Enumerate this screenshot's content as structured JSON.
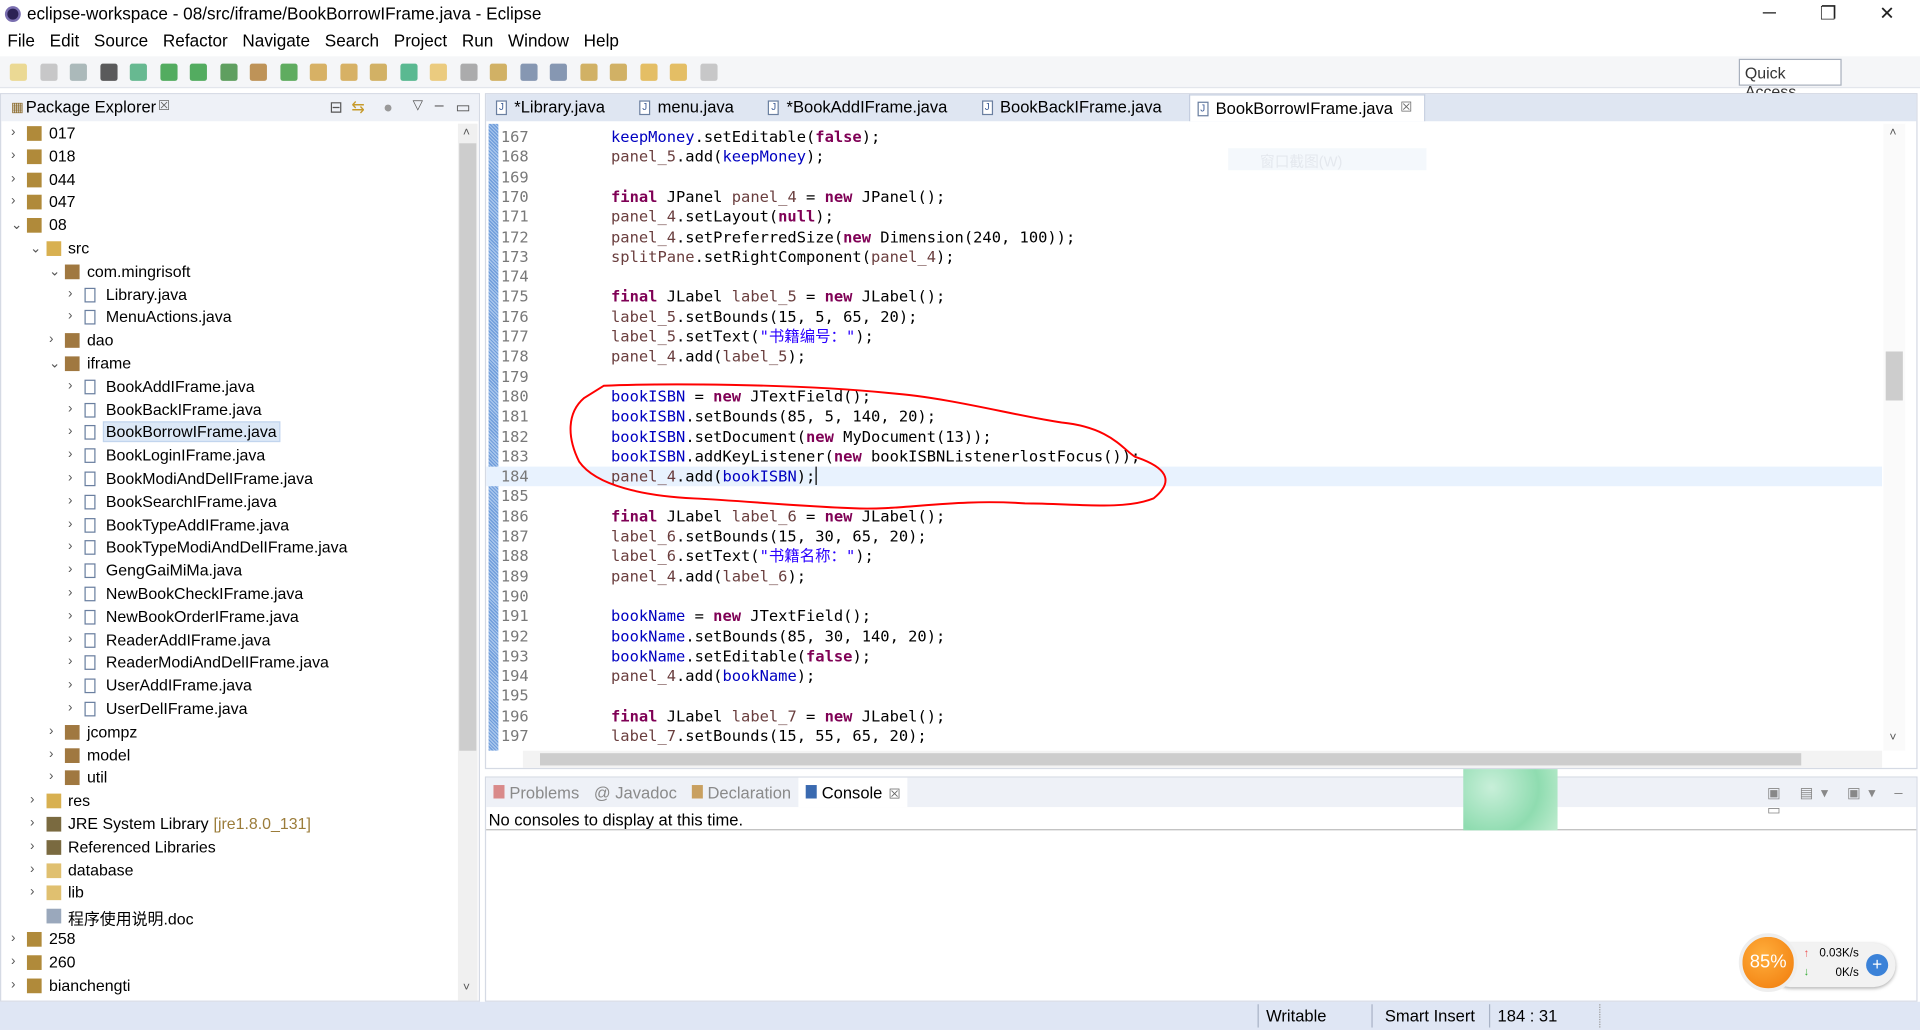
{
  "window": {
    "title": "eclipse-workspace - 08/src/iframe/BookBorrowIFrame.java - Eclipse",
    "minimize": "─",
    "restore": "❐",
    "close": "✕"
  },
  "menu": [
    "File",
    "Edit",
    "Source",
    "Refactor",
    "Navigate",
    "Search",
    "Project",
    "Run",
    "Window",
    "Help"
  ],
  "quick_access": "Quick Access",
  "package_explorer": {
    "title": "Package Explorer",
    "close": "☒",
    "items": [
      {
        "label": "017",
        "level": 0,
        "arrow": "›",
        "icon": "project"
      },
      {
        "label": "018",
        "level": 0,
        "arrow": "›",
        "icon": "project"
      },
      {
        "label": "044",
        "level": 0,
        "arrow": "›",
        "icon": "project"
      },
      {
        "label": "047",
        "level": 0,
        "arrow": "›",
        "icon": "project"
      },
      {
        "label": "08",
        "level": 0,
        "arrow": "⌄",
        "icon": "project"
      },
      {
        "label": "src",
        "level": 1,
        "arrow": "⌄",
        "icon": "srcfolder"
      },
      {
        "label": "com.mingrisoft",
        "level": 2,
        "arrow": "⌄",
        "icon": "package"
      },
      {
        "label": "Library.java",
        "level": 3,
        "arrow": "›",
        "icon": "java"
      },
      {
        "label": "MenuActions.java",
        "level": 3,
        "arrow": "›",
        "icon": "java"
      },
      {
        "label": "dao",
        "level": 2,
        "arrow": "›",
        "icon": "package"
      },
      {
        "label": "iframe",
        "level": 2,
        "arrow": "⌄",
        "icon": "package"
      },
      {
        "label": "BookAddIFrame.java",
        "level": 3,
        "arrow": "›",
        "icon": "java"
      },
      {
        "label": "BookBackIFrame.java",
        "level": 3,
        "arrow": "›",
        "icon": "java"
      },
      {
        "label": "BookBorrowIFrame.java",
        "level": 3,
        "arrow": "›",
        "icon": "java",
        "selected": true
      },
      {
        "label": "BookLoginIFrame.java",
        "level": 3,
        "arrow": "›",
        "icon": "java"
      },
      {
        "label": "BookModiAndDelIFrame.java",
        "level": 3,
        "arrow": "›",
        "icon": "java"
      },
      {
        "label": "BookSearchIFrame.java",
        "level": 3,
        "arrow": "›",
        "icon": "java"
      },
      {
        "label": "BookTypeAddIFrame.java",
        "level": 3,
        "arrow": "›",
        "icon": "java"
      },
      {
        "label": "BookTypeModiAndDelIFrame.java",
        "level": 3,
        "arrow": "›",
        "icon": "java"
      },
      {
        "label": "GengGaiMiMa.java",
        "level": 3,
        "arrow": "›",
        "icon": "java"
      },
      {
        "label": "NewBookCheckIFrame.java",
        "level": 3,
        "arrow": "›",
        "icon": "java"
      },
      {
        "label": "NewBookOrderIFrame.java",
        "level": 3,
        "arrow": "›",
        "icon": "java"
      },
      {
        "label": "ReaderAddIFrame.java",
        "level": 3,
        "arrow": "›",
        "icon": "java"
      },
      {
        "label": "ReaderModiAndDelIFrame.java",
        "level": 3,
        "arrow": "›",
        "icon": "java"
      },
      {
        "label": "UserAddIFrame.java",
        "level": 3,
        "arrow": "›",
        "icon": "java"
      },
      {
        "label": "UserDelIFrame.java",
        "level": 3,
        "arrow": "›",
        "icon": "java"
      },
      {
        "label": "jcompz",
        "level": 2,
        "arrow": "›",
        "icon": "package"
      },
      {
        "label": "model",
        "level": 2,
        "arrow": "›",
        "icon": "package"
      },
      {
        "label": "util",
        "level": 2,
        "arrow": "›",
        "icon": "package"
      },
      {
        "label": "res",
        "level": 1,
        "arrow": "›",
        "icon": "srcfolder"
      },
      {
        "label": "JRE System Library",
        "decoration": "[jre1.8.0_131]",
        "level": 1,
        "arrow": "›",
        "icon": "library"
      },
      {
        "label": "Referenced Libraries",
        "level": 1,
        "arrow": "›",
        "icon": "library"
      },
      {
        "label": "database",
        "level": 1,
        "arrow": "›",
        "icon": "folder"
      },
      {
        "label": "lib",
        "level": 1,
        "arrow": "›",
        "icon": "folder"
      },
      {
        "label": "程序使用说明.doc",
        "level": 1,
        "arrow": "",
        "icon": "file"
      },
      {
        "label": "258",
        "level": 0,
        "arrow": "›",
        "icon": "project"
      },
      {
        "label": "260",
        "level": 0,
        "arrow": "›",
        "icon": "project"
      },
      {
        "label": "bianchengti",
        "level": 0,
        "arrow": "›",
        "icon": "project"
      }
    ]
  },
  "editor": {
    "tabs": [
      {
        "label": "*Library.java"
      },
      {
        "label": "menu.java"
      },
      {
        "label": "*BookAddIFrame.java"
      },
      {
        "label": "BookBackIFrame.java"
      },
      {
        "label": "BookBorrowIFrame.java",
        "active": true,
        "close": "☒"
      }
    ],
    "current_line": 184,
    "lines": [
      {
        "n": "167",
        "tokens": [
          [
            "keepMoney",
            "f"
          ],
          [
            ".setEditable(",
            "p"
          ],
          [
            "false",
            "k"
          ],
          [
            ");",
            "p"
          ]
        ]
      },
      {
        "n": "168",
        "tokens": [
          [
            "panel_5",
            "v"
          ],
          [
            ".add(",
            "p"
          ],
          [
            "keepMoney",
            "f"
          ],
          [
            ");",
            "p"
          ]
        ]
      },
      {
        "n": "169",
        "tokens": []
      },
      {
        "n": "170",
        "tokens": [
          [
            "final",
            "k"
          ],
          [
            " JPanel ",
            "p"
          ],
          [
            "panel_4",
            "v"
          ],
          [
            " = ",
            "p"
          ],
          [
            "new",
            "k"
          ],
          [
            " JPanel();",
            "p"
          ]
        ]
      },
      {
        "n": "171",
        "tokens": [
          [
            "panel_4",
            "v"
          ],
          [
            ".setLayout(",
            "p"
          ],
          [
            "null",
            "k"
          ],
          [
            ");",
            "p"
          ]
        ]
      },
      {
        "n": "172",
        "tokens": [
          [
            "panel_4",
            "v"
          ],
          [
            ".setPreferredSize(",
            "p"
          ],
          [
            "new",
            "k"
          ],
          [
            " Dimension(240, 100));",
            "p"
          ]
        ]
      },
      {
        "n": "173",
        "tokens": [
          [
            "splitPane",
            "v"
          ],
          [
            ".setRightComponent(",
            "p"
          ],
          [
            "panel_4",
            "v"
          ],
          [
            ");",
            "p"
          ]
        ]
      },
      {
        "n": "174",
        "tokens": []
      },
      {
        "n": "175",
        "tokens": [
          [
            "final",
            "k"
          ],
          [
            " JLabel ",
            "p"
          ],
          [
            "label_5",
            "v"
          ],
          [
            " = ",
            "p"
          ],
          [
            "new",
            "k"
          ],
          [
            " JLabel();",
            "p"
          ]
        ]
      },
      {
        "n": "176",
        "tokens": [
          [
            "label_5",
            "v"
          ],
          [
            ".setBounds(15, 5, 65, 20);",
            "p"
          ]
        ]
      },
      {
        "n": "177",
        "tokens": [
          [
            "label_5",
            "v"
          ],
          [
            ".setText(",
            "p"
          ],
          [
            "\"书籍编号：\"",
            "s"
          ],
          [
            ");",
            "p"
          ]
        ]
      },
      {
        "n": "178",
        "tokens": [
          [
            "panel_4",
            "v"
          ],
          [
            ".add(",
            "p"
          ],
          [
            "label_5",
            "v"
          ],
          [
            ");",
            "p"
          ]
        ]
      },
      {
        "n": "179",
        "tokens": []
      },
      {
        "n": "180",
        "tokens": [
          [
            "bookISBN",
            "f"
          ],
          [
            " = ",
            "p"
          ],
          [
            "new",
            "k"
          ],
          [
            " JTextField();",
            "p"
          ]
        ]
      },
      {
        "n": "181",
        "tokens": [
          [
            "bookISBN",
            "f"
          ],
          [
            ".setBounds(85, 5, 140, 20);",
            "p"
          ]
        ]
      },
      {
        "n": "182",
        "tokens": [
          [
            "bookISBN",
            "f"
          ],
          [
            ".setDocument(",
            "p"
          ],
          [
            "new",
            "k"
          ],
          [
            " MyDocument(13));",
            "p"
          ]
        ]
      },
      {
        "n": "183",
        "tokens": [
          [
            "bookISBN",
            "f"
          ],
          [
            ".addKeyListener(",
            "p"
          ],
          [
            "new",
            "k"
          ],
          [
            " bookISBNListenerlostFocus());",
            "p"
          ]
        ]
      },
      {
        "n": "184",
        "tokens": [
          [
            "panel_4",
            "v"
          ],
          [
            ".add(",
            "p"
          ],
          [
            "bookISBN",
            "f"
          ],
          [
            ");",
            "p"
          ]
        ]
      },
      {
        "n": "185",
        "tokens": []
      },
      {
        "n": "186",
        "tokens": [
          [
            "final",
            "k"
          ],
          [
            " JLabel ",
            "p"
          ],
          [
            "label_6",
            "v"
          ],
          [
            " = ",
            "p"
          ],
          [
            "new",
            "k"
          ],
          [
            " JLabel();",
            "p"
          ]
        ]
      },
      {
        "n": "187",
        "tokens": [
          [
            "label_6",
            "v"
          ],
          [
            ".setBounds(15, 30, 65, 20);",
            "p"
          ]
        ]
      },
      {
        "n": "188",
        "tokens": [
          [
            "label_6",
            "v"
          ],
          [
            ".setText(",
            "p"
          ],
          [
            "\"书籍名称：\"",
            "s"
          ],
          [
            ");",
            "p"
          ]
        ]
      },
      {
        "n": "189",
        "tokens": [
          [
            "panel_4",
            "v"
          ],
          [
            ".add(",
            "p"
          ],
          [
            "label_6",
            "v"
          ],
          [
            ");",
            "p"
          ]
        ]
      },
      {
        "n": "190",
        "tokens": []
      },
      {
        "n": "191",
        "tokens": [
          [
            "bookName",
            "f"
          ],
          [
            " = ",
            "p"
          ],
          [
            "new",
            "k"
          ],
          [
            " JTextField();",
            "p"
          ]
        ]
      },
      {
        "n": "192",
        "tokens": [
          [
            "bookName",
            "f"
          ],
          [
            ".setBounds(85, 30, 140, 20);",
            "p"
          ]
        ]
      },
      {
        "n": "193",
        "tokens": [
          [
            "bookName",
            "f"
          ],
          [
            ".setEditable(",
            "p"
          ],
          [
            "false",
            "k"
          ],
          [
            ");",
            "p"
          ]
        ]
      },
      {
        "n": "194",
        "tokens": [
          [
            "panel_4",
            "v"
          ],
          [
            ".add(",
            "p"
          ],
          [
            "bookName",
            "f"
          ],
          [
            ");",
            "p"
          ]
        ]
      },
      {
        "n": "195",
        "tokens": []
      },
      {
        "n": "196",
        "tokens": [
          [
            "final",
            "k"
          ],
          [
            " JLabel ",
            "p"
          ],
          [
            "label_7",
            "v"
          ],
          [
            " = ",
            "p"
          ],
          [
            "new",
            "k"
          ],
          [
            " JLabel();",
            "p"
          ]
        ]
      },
      {
        "n": "197",
        "tokens": [
          [
            "label_7",
            "v"
          ],
          [
            ".setBounds(15, 55, 65, 20);",
            "p"
          ]
        ]
      }
    ],
    "tooltip_ghost": "窗口截图(W)"
  },
  "bottom": {
    "tabs": [
      {
        "label": "Problems"
      },
      {
        "label": "@ Javadoc"
      },
      {
        "label": "Declaration"
      },
      {
        "label": "Console",
        "active": true,
        "close": "☒"
      }
    ],
    "console_text": "No consoles to display at this time."
  },
  "status": {
    "writable": "Writable",
    "insert_mode": "Smart Insert",
    "position": "184 : 31"
  },
  "net_widget": {
    "percent": "85%",
    "upload": "0.03K/s",
    "download": "0K/s"
  },
  "colors": {
    "keyword": "#7f0055",
    "field": "#0000c0",
    "string": "#2a00ff",
    "local": "#6a3e3e",
    "annotation": "#ff0000"
  }
}
